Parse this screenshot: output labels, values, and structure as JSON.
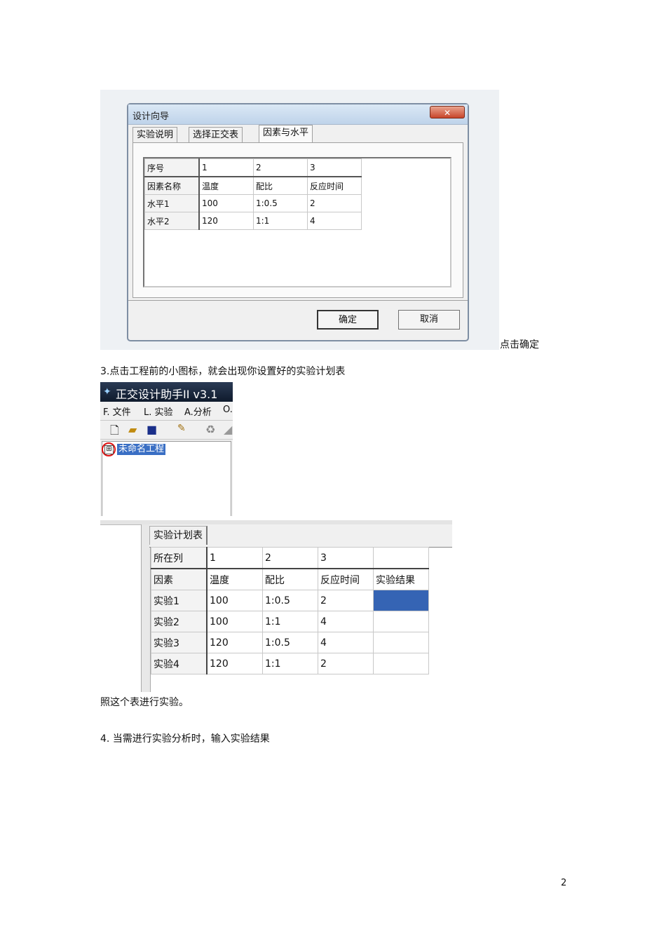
{
  "wizard": {
    "title": "设计向导",
    "close_glyph": "✕",
    "tabs": [
      "实验说明",
      "选择正交表",
      "因素与水平"
    ],
    "grid": {
      "rows": [
        [
          "序号",
          "1",
          "2",
          "3"
        ],
        [
          "因素名称",
          "温度",
          "配比",
          "反应时间"
        ],
        [
          "水平1",
          "100",
          "1:0.5",
          "2"
        ],
        [
          "水平2",
          "120",
          "1:1",
          "4"
        ]
      ]
    },
    "ok_label": "确定",
    "cancel_label": "取消"
  },
  "caption_1": "点击确定",
  "step_3": "3.点击工程前的小图标，就会出现你设置好的实验计划表",
  "app": {
    "title": "正交设计助手II v3.1",
    "menu": [
      "F. 文件",
      "L. 实验",
      "A.分析",
      "O."
    ],
    "tree_item": "未命名工程",
    "tree_expander": "⊞"
  },
  "plan": {
    "tab_label": "实验计划表",
    "rows": [
      [
        "所在列",
        "1",
        "2",
        "3",
        ""
      ],
      [
        "因素",
        "温度",
        "配比",
        "反应时间",
        "实验结果"
      ],
      [
        "实验1",
        "100",
        "1:0.5",
        "2",
        ""
      ],
      [
        "实验2",
        "100",
        "1:1",
        "4",
        ""
      ],
      [
        "实验3",
        "120",
        "1:0.5",
        "4",
        ""
      ],
      [
        "实验4",
        "120",
        "1:1",
        "2",
        ""
      ]
    ]
  },
  "caption_2": "照这个表进行实验。",
  "step_4": "4.  当需进行实验分析时，输入实验结果",
  "page_number": "2"
}
